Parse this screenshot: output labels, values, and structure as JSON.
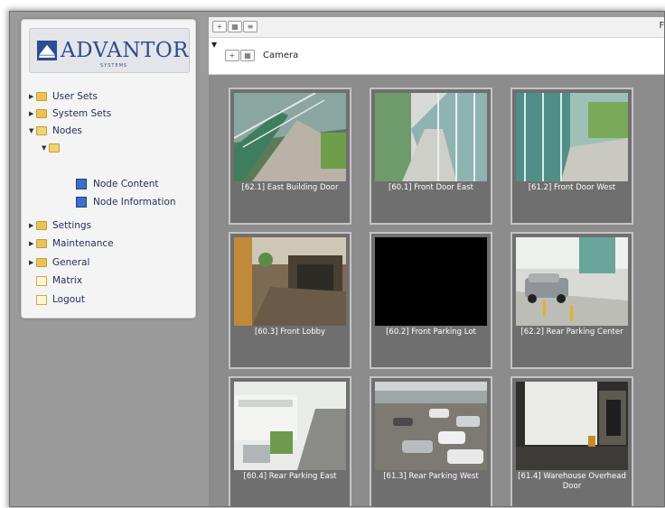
{
  "brand": {
    "logo_text": "ADVANTOR",
    "logo_sub": "SYSTEMS"
  },
  "sidebar": {
    "items": [
      {
        "label": "User Sets"
      },
      {
        "label": "System Sets"
      },
      {
        "label": "Nodes"
      },
      {
        "label": ""
      },
      {
        "label": "Node Content"
      },
      {
        "label": "Node Information"
      },
      {
        "label": "Settings"
      },
      {
        "label": "Maintenance"
      },
      {
        "label": "General"
      },
      {
        "label": "Matrix"
      },
      {
        "label": "Logout"
      }
    ]
  },
  "toolbar": {
    "btn_plus": "+",
    "btn_grid": "▦",
    "btn_list": "≡",
    "right_label": "Fo"
  },
  "camera_panel": {
    "title": "Camera",
    "btn_plus": "+",
    "btn_grid": "▦"
  },
  "cameras": [
    {
      "label": "[62.1] East Building Door"
    },
    {
      "label": "[60.1] Front Door East"
    },
    {
      "label": "[61.2] Front Door West"
    },
    {
      "label": "[60.3] Front Lobby"
    },
    {
      "label": "[60.2] Front Parking Lot"
    },
    {
      "label": "[62.2] Rear Parking Center"
    },
    {
      "label": "[60.4] Rear Parking East"
    },
    {
      "label": "[61.3] Rear Parking West"
    },
    {
      "label": "[61.4] Warehouse Overhead Door"
    }
  ]
}
